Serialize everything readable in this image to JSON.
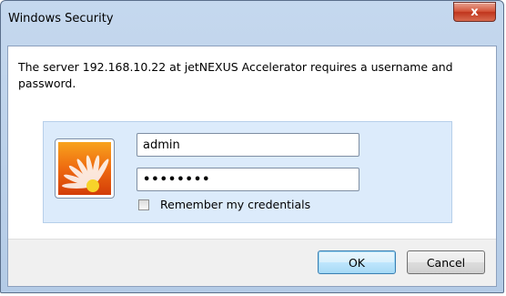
{
  "window": {
    "title": "Windows Security",
    "close_label": "x"
  },
  "message": "The server 192.168.10.22 at jetNEXUS Accelerator requires a username and password.",
  "credentials": {
    "username_value": "admin",
    "password_value": "••••••••",
    "remember_label": "Remember my credentials",
    "remember_checked": false,
    "tile_icon": "user-tile-flower-icon"
  },
  "buttons": {
    "ok_label": "OK",
    "cancel_label": "Cancel"
  },
  "colors": {
    "frame": "#b4cbe6",
    "panel": "#dcebfb",
    "close": "#c0351d"
  }
}
